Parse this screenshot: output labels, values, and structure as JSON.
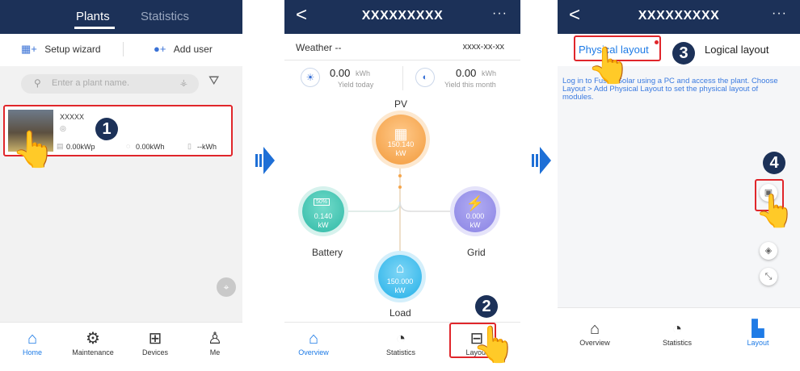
{
  "screen1": {
    "tabs": [
      "Plants",
      "Statistics"
    ],
    "setup_wizard": "Setup wizard",
    "add_user": "Add user",
    "search_placeholder": "Enter a plant name.",
    "plant": {
      "name": "XXXXX",
      "capacity": "0.00kWp",
      "energy": "0.00kWh",
      "revenue": "--kWh"
    },
    "nav": [
      "Home",
      "Maintenance",
      "Devices",
      "Me"
    ],
    "callout": "1"
  },
  "screen2": {
    "title": "XXXXXXXXX",
    "back": "<",
    "more": "···",
    "weather": "Weather --",
    "date": "xxxx-xx-xx",
    "yield_today": {
      "value": "0.00",
      "unit": "kWh",
      "label": "Yield today"
    },
    "yield_month": {
      "value": "0.00",
      "unit": "kWh",
      "label": "Yield this month"
    },
    "pv": {
      "label": "PV",
      "value": "150.140",
      "unit": "kW"
    },
    "battery": {
      "label": "Battery",
      "value": "0.140",
      "unit": "kW",
      "soc": "50%"
    },
    "grid": {
      "label": "Grid",
      "value": "0.000",
      "unit": "kW"
    },
    "load": {
      "label": "Load",
      "value": "150.000",
      "unit": "kW"
    },
    "nav": [
      "Overview",
      "Statistics",
      "Layout"
    ],
    "callout": "2"
  },
  "screen3": {
    "title": "XXXXXXXXX",
    "back": "<",
    "more": "···",
    "tab_physical": "Physical layout",
    "tab_logical": "Logical layout",
    "info": "Log in to FusionSolar using a PC and access the plant. Choose Layout > Add Physical Layout to set the physical layout of modules.",
    "nav": [
      "Overview",
      "Statistics",
      "Layout"
    ],
    "callout3": "3",
    "callout4": "4"
  },
  "colors": {
    "navy": "#1c3158",
    "accent": "#1e7be6",
    "highlight": "#e0262b",
    "pv": "#f6a54b",
    "battery": "#3cc3b0",
    "grid": "#8b84e6",
    "load": "#29b8ec"
  }
}
